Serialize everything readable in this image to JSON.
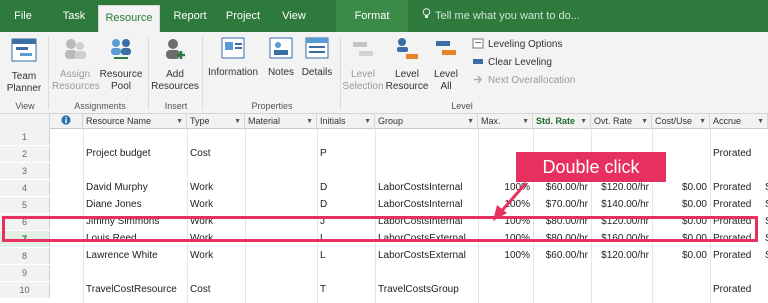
{
  "menu": {
    "tabs": [
      {
        "label": "File",
        "active": false
      },
      {
        "label": "Task",
        "active": false
      },
      {
        "label": "Resource",
        "active": true
      },
      {
        "label": "Report",
        "active": false
      },
      {
        "label": "Project",
        "active": false
      },
      {
        "label": "View",
        "active": false
      },
      {
        "label": "Format",
        "active": false
      }
    ],
    "tellme": "Tell me what you want to do..."
  },
  "ribbon": {
    "view": {
      "team_planner": "Team Planner",
      "group_label": "View"
    },
    "assignments": {
      "assign": "Assign Resources",
      "resource_pool": "Resource Pool",
      "group_label": "Assignments"
    },
    "insert": {
      "add_resources": "Add Resources",
      "group_label": "Insert"
    },
    "properties": {
      "information": "Information",
      "notes": "Notes",
      "details": "Details",
      "group_label": "Properties"
    },
    "level": {
      "level_selection": "Level Selection",
      "level_resource": "Level Resource",
      "level_all": "Level All",
      "leveling_options": "Leveling Options",
      "clear_leveling": "Clear Leveling",
      "next_overallocation": "Next Overallocation",
      "group_label": "Level"
    }
  },
  "sheet": {
    "headers": [
      "",
      "Resource Name",
      "Type",
      "Material",
      "Initials",
      "Group",
      "Max.",
      "Std. Rate",
      "Ovt. Rate",
      "Cost/Use",
      "Accrue"
    ],
    "rows": [
      {
        "num": "1",
        "name": "",
        "type": "",
        "material": "",
        "initials": "",
        "group": "",
        "max": "",
        "std": "",
        "ovt": "",
        "cost": "",
        "accrue": "",
        "extra": ""
      },
      {
        "num": "2",
        "name": "Project budget",
        "type": "Cost",
        "material": "",
        "initials": "P",
        "group": "",
        "max": "",
        "std": "",
        "ovt": "",
        "cost": "",
        "accrue": "Prorated",
        "extra": ""
      },
      {
        "num": "3",
        "name": "",
        "type": "",
        "material": "",
        "initials": "",
        "group": "",
        "max": "",
        "std": "",
        "ovt": "",
        "cost": "",
        "accrue": "",
        "extra": ""
      },
      {
        "num": "4",
        "name": "David Murphy",
        "type": "Work",
        "material": "",
        "initials": "D",
        "group": "LaborCostsInternal",
        "max": "100%",
        "std": "$60.00/hr",
        "ovt": "$120.00/hr",
        "cost": "$0.00",
        "accrue": "Prorated",
        "extra": "S"
      },
      {
        "num": "5",
        "name": "Diane Jones",
        "type": "Work",
        "material": "",
        "initials": "D",
        "group": "LaborCostsInternal",
        "max": "100%",
        "std": "$70.00/hr",
        "ovt": "$140.00/hr",
        "cost": "$0.00",
        "accrue": "Prorated",
        "extra": "S"
      },
      {
        "num": "6",
        "name": "Jimmy Simmons",
        "type": "Work",
        "material": "",
        "initials": "J",
        "group": "LaborCostsInternal",
        "max": "100%",
        "std": "$80.00/hr",
        "ovt": "$120.00/hr",
        "cost": "$0.00",
        "accrue": "Prorated",
        "extra": "S"
      },
      {
        "num": "7",
        "name": "Louis Reed",
        "type": "Work",
        "material": "",
        "initials": "L",
        "group": "LaborCostsExternal",
        "max": "100%",
        "std": "$80.00/hr",
        "ovt": "$160.00/hr",
        "cost": "$0.00",
        "accrue": "Prorated",
        "extra": "S"
      },
      {
        "num": "8",
        "name": "Lawrence White",
        "type": "Work",
        "material": "",
        "initials": "L",
        "group": "LaborCostsExternal",
        "max": "100%",
        "std": "$60.00/hr",
        "ovt": "$120.00/hr",
        "cost": "$0.00",
        "accrue": "Prorated",
        "extra": "S"
      },
      {
        "num": "9",
        "name": "",
        "type": "",
        "material": "",
        "initials": "",
        "group": "",
        "max": "",
        "std": "",
        "ovt": "",
        "cost": "",
        "accrue": "",
        "extra": ""
      },
      {
        "num": "10",
        "name": "TravelCostResource",
        "type": "Cost",
        "material": "",
        "initials": "T",
        "group": "TravelCostsGroup",
        "max": "",
        "std": "",
        "ovt": "",
        "cost": "",
        "accrue": "Prorated",
        "extra": ""
      }
    ],
    "selected_row": "7"
  },
  "annotation": {
    "callout": "Double click"
  },
  "colors": {
    "brand": "#2e7a3c",
    "callout": "#e6305f"
  }
}
